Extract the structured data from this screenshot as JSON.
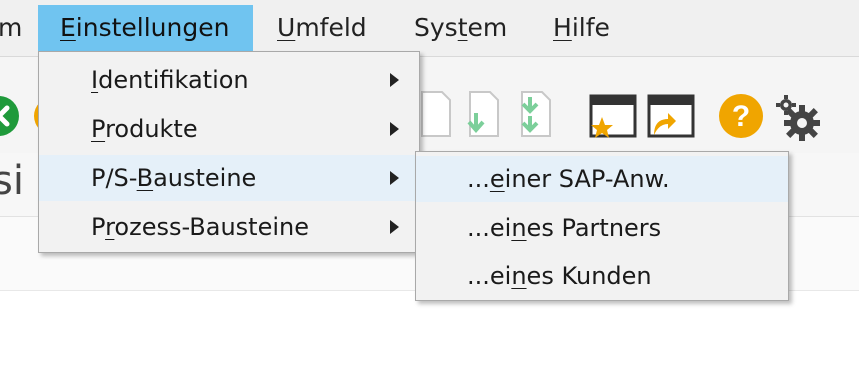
{
  "menubar": {
    "items": [
      {
        "text": "m",
        "ul": "",
        "rest": ""
      },
      {
        "pre": "",
        "ul": "E",
        "rest": "instellungen"
      },
      {
        "pre": "",
        "ul": "U",
        "rest": "mfeld"
      },
      {
        "pre": "Sys",
        "ul": "t",
        "rest": "em"
      },
      {
        "pre": "",
        "ul": "H",
        "rest": "ilfe"
      }
    ]
  },
  "toolbar": {
    "partial_text": "si",
    "icons": [
      "green-exit-icon",
      "orange-cancel-icon",
      "download-doc-icon",
      "download-doc-icon",
      "download-doc-double-icon",
      "favorites-window-icon",
      "shortcut-window-icon",
      "help-icon",
      "settings-gear-icon"
    ],
    "help_glyph": "?"
  },
  "menu": {
    "items": [
      {
        "pre": "",
        "ul": "I",
        "rest": "dentifikation"
      },
      {
        "pre": "",
        "ul": "P",
        "rest": "rodukte"
      },
      {
        "pre": "P/S-",
        "ul": "B",
        "rest": "austeine"
      },
      {
        "pre": "P",
        "ul": "r",
        "rest": "ozess-Bausteine"
      }
    ]
  },
  "submenu": {
    "items": [
      {
        "pre": "...",
        "ul": "e",
        "rest": "iner SAP-Anw."
      },
      {
        "pre": "...ei",
        "ul": "n",
        "rest": "es Partners"
      },
      {
        "pre": "...ei",
        "ul": "n",
        "rest": "es Kunden"
      }
    ]
  },
  "colors": {
    "menubar_bg": "#f0f0f0",
    "active_menu": "#70c4f0",
    "menu_bg": "#f2f2f2",
    "hover": "#e5f0f9",
    "help_icon": "#f0a500",
    "exit_icon": "#1f9a3b",
    "download_arrow": "#7ccf9a"
  }
}
